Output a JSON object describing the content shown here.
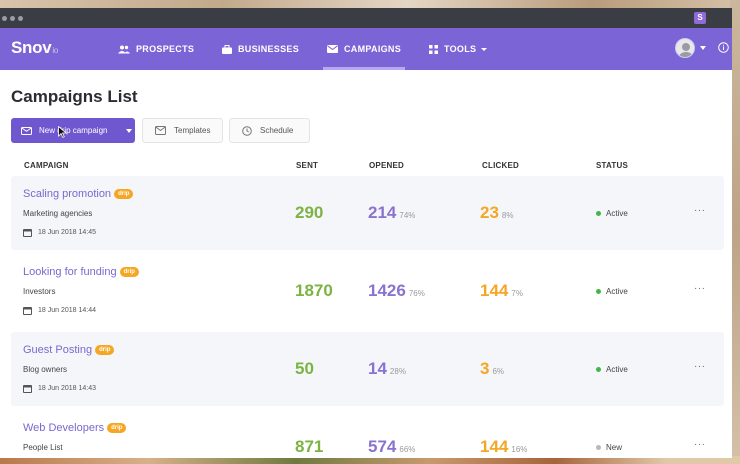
{
  "app": {
    "logo": "Snov",
    "logo_suffix": "io",
    "ext_badge": "S"
  },
  "nav": {
    "items": [
      {
        "label": "PROSPECTS",
        "icon": "people-icon"
      },
      {
        "label": "BUSINESSES",
        "icon": "briefcase-icon"
      },
      {
        "label": "CAMPAIGNS",
        "icon": "envelope-icon",
        "active": true
      },
      {
        "label": "TOOLS",
        "icon": "grid-icon"
      }
    ]
  },
  "page": {
    "title": "Campaigns List",
    "new_campaign_label": "New drip campaign",
    "templates_label": "Templates",
    "schedule_label": "Schedule"
  },
  "table": {
    "headers": {
      "campaign": "CAMPAIGN",
      "sent": "SENT",
      "opened": "OPENED",
      "clicked": "CLICKED",
      "status": "STATUS"
    },
    "rows": [
      {
        "name": "Scaling promotion",
        "badge": "drip",
        "list": "Marketing agencies",
        "date": "18 Jun 2018 14:45",
        "sent": "290",
        "opened": "214",
        "opened_pct": "74%",
        "clicked": "23",
        "clicked_pct": "8%",
        "status": "Active",
        "status_color": "#43b649",
        "more": "···"
      },
      {
        "name": "Looking for funding",
        "badge": "drip",
        "list": "Investors",
        "date": "18 Jun 2018 14:44",
        "sent": "1870",
        "opened": "1426",
        "opened_pct": "76%",
        "clicked": "144",
        "clicked_pct": "7%",
        "status": "Active",
        "status_color": "#43b649",
        "more": "···"
      },
      {
        "name": "Guest Posting",
        "badge": "drip",
        "list": "Blog owners",
        "date": "18 Jun 2018 14:43",
        "sent": "50",
        "opened": "14",
        "opened_pct": "28%",
        "clicked": "3",
        "clicked_pct": "6%",
        "status": "Active",
        "status_color": "#43b649",
        "more": "···"
      },
      {
        "name": "Web Developers",
        "badge": "drip",
        "list": "People List",
        "date": "",
        "sent": "871",
        "opened": "574",
        "opened_pct": "66%",
        "clicked": "144",
        "clicked_pct": "16%",
        "status": "New",
        "status_color": "#b8b8be",
        "more": "···"
      }
    ]
  },
  "colors": {
    "nav_bg": "#7b64d6",
    "primary_button": "#6f58cf",
    "sent": "#7cb342",
    "opened": "#8a72d1",
    "clicked": "#f5a623",
    "badge": "#f5a623"
  }
}
